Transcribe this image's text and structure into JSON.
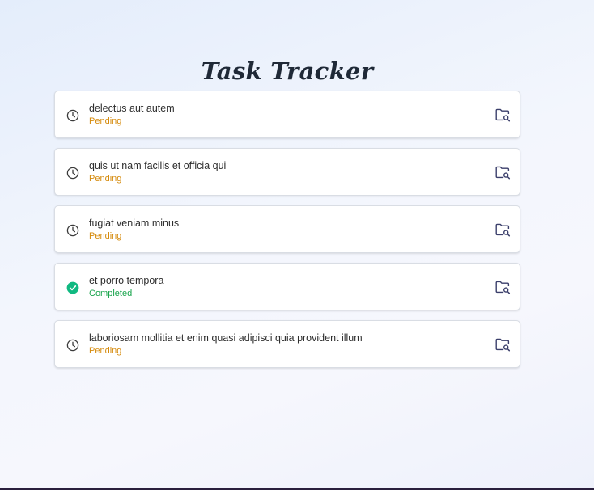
{
  "page": {
    "title": "Task Tracker"
  },
  "colors": {
    "pending": "#d58a0b",
    "completed": "#16a34a",
    "completed_icon": "#10b981",
    "folder_icon": "#3b3f6b"
  },
  "tasks": [
    {
      "title": "delectus aut autem",
      "status": "Pending",
      "status_icon": "clock-icon",
      "action_icon": "folder-search-icon"
    },
    {
      "title": "quis ut nam facilis et officia qui",
      "status": "Pending",
      "status_icon": "clock-icon",
      "action_icon": "folder-search-icon"
    },
    {
      "title": "fugiat veniam minus",
      "status": "Pending",
      "status_icon": "clock-icon",
      "action_icon": "folder-search-icon"
    },
    {
      "title": "et porro tempora",
      "status": "Completed",
      "status_icon": "check-circle-icon",
      "action_icon": "folder-search-icon"
    },
    {
      "title": "laboriosam mollitia et enim quasi adipisci quia provident illum",
      "status": "Pending",
      "status_icon": "clock-icon",
      "action_icon": "folder-search-icon"
    }
  ]
}
